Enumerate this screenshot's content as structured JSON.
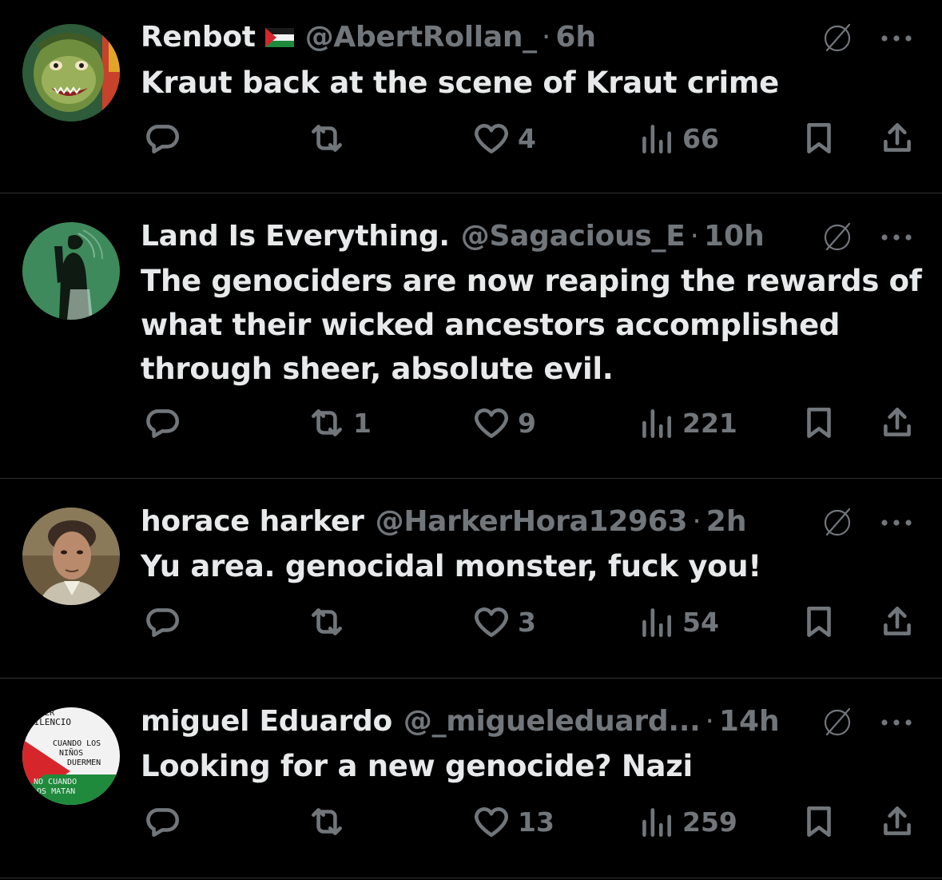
{
  "replies": [
    {
      "name": "Renbot",
      "has_flag": true,
      "handle": "@AbertRollan_",
      "separator": "·",
      "time": "6h",
      "text": "Kraut back at the scene of Kraut crime",
      "replies_count": "",
      "reposts": "",
      "likes": "4",
      "views": "66"
    },
    {
      "name": "Land Is Everything.",
      "has_flag": false,
      "handle": "@Sagacious_E",
      "separator": "·",
      "time": "10h",
      "text_lines": [
        "The genociders are now reaping the rewards of",
        "what their wicked ancestors accomplished",
        "through sheer, absolute evil."
      ],
      "replies_count": "",
      "reposts": "1",
      "likes": "9",
      "views": "221"
    },
    {
      "name": "horace harker",
      "has_flag": false,
      "handle": "@HarkerHora12963",
      "separator": "·",
      "time": "2h",
      "text": "Yu area. genocidal monster, fuck you!",
      "replies_count": "",
      "reposts": "",
      "likes": "3",
      "views": "54"
    },
    {
      "name": "miguel Eduardo",
      "has_flag": false,
      "handle": "@_migueleduard...",
      "separator": "·",
      "time": "14h",
      "text": "Looking for a new genocide? Nazi",
      "replies_count": "",
      "reposts": "",
      "likes": "13",
      "views": "259",
      "avatar_text": [
        "HACER",
        "SILENCIO",
        "CUANDO LOS",
        "NIÑOS",
        "DUERMEN",
        "NO CUANDO",
        "LOS MATAN"
      ]
    }
  ],
  "icons": {
    "reply": "reply-icon",
    "repost": "repost-icon",
    "like": "heart-icon",
    "views": "views-icon",
    "bookmark": "bookmark-icon",
    "share": "share-icon",
    "grok": "grok-icon",
    "more": "more-icon"
  },
  "colors": {
    "background": "#000000",
    "text": "#e7e9ea",
    "muted": "#71767b",
    "divider": "#2f3336"
  }
}
